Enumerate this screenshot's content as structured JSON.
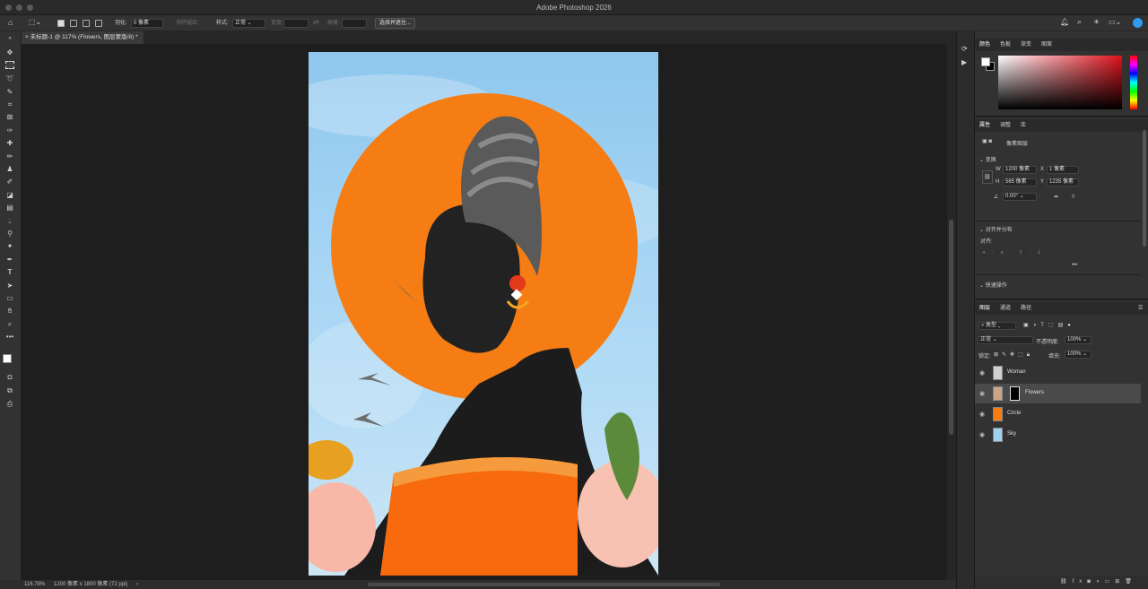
{
  "app": {
    "title": "Adobe Photoshop 2026"
  },
  "options": {
    "feather_label": "羽化:",
    "feather_value": "0 像素",
    "antialias": "消除锯齿",
    "style_label": "样式:",
    "style_value": "正常",
    "width_label": "宽度:",
    "height_label": "高度:",
    "select_mask": "选择并遮住..."
  },
  "document": {
    "tab_title": "未标题-1 @ 117% (Flowers, 图层蒙版/8) *"
  },
  "status": {
    "zoom": "116.78%",
    "doc_info": "1200 像素 x 1800 像素 (72 ppi)"
  },
  "color_panel": {
    "tabs": [
      "颜色",
      "色板",
      "渐变",
      "图案"
    ]
  },
  "properties_panel": {
    "tabs": [
      "属性",
      "调整",
      "库"
    ],
    "layer_type": "像素图层",
    "transform_label": "变换",
    "w_label": "W",
    "w_value": "1200 像素",
    "x_label": "X",
    "x_value": "1 像素",
    "h_label": "H",
    "h_value": "565 像素",
    "y_label": "Y",
    "y_value": "1235 像素",
    "angle_value": "0.00°",
    "align_label": "对齐并分布",
    "align_to": "对齐:",
    "more": "•••",
    "quick_label": "快速操作"
  },
  "layers_panel": {
    "tabs": [
      "图层",
      "通道",
      "路径"
    ],
    "filter_kind": "类型",
    "blend_mode": "正常",
    "opacity_label": "不透明度:",
    "opacity_value": "100%",
    "lock_label": "锁定:",
    "fill_label": "填充:",
    "fill_value": "100%",
    "layers": [
      {
        "name": "Woman",
        "thumb_color": "#cfcfcf",
        "selected": false,
        "has_mask": false
      },
      {
        "name": "Flowers",
        "thumb_color": "#c9a58a",
        "selected": true,
        "has_mask": true
      },
      {
        "name": "Circle",
        "thumb_color": "#f57d14",
        "selected": false,
        "has_mask": false
      },
      {
        "name": "Sky",
        "thumb_color": "#9fd0f0",
        "selected": false,
        "has_mask": false
      }
    ],
    "footer_icons": [
      "link-icon",
      "fx-icon",
      "mask-icon",
      "adjustment-icon",
      "group-icon",
      "new-layer-icon",
      "trash-icon"
    ]
  },
  "colors": {
    "accent": "#2f9bf0",
    "orange": "#f57d14",
    "sky": "#9fd0f0"
  }
}
